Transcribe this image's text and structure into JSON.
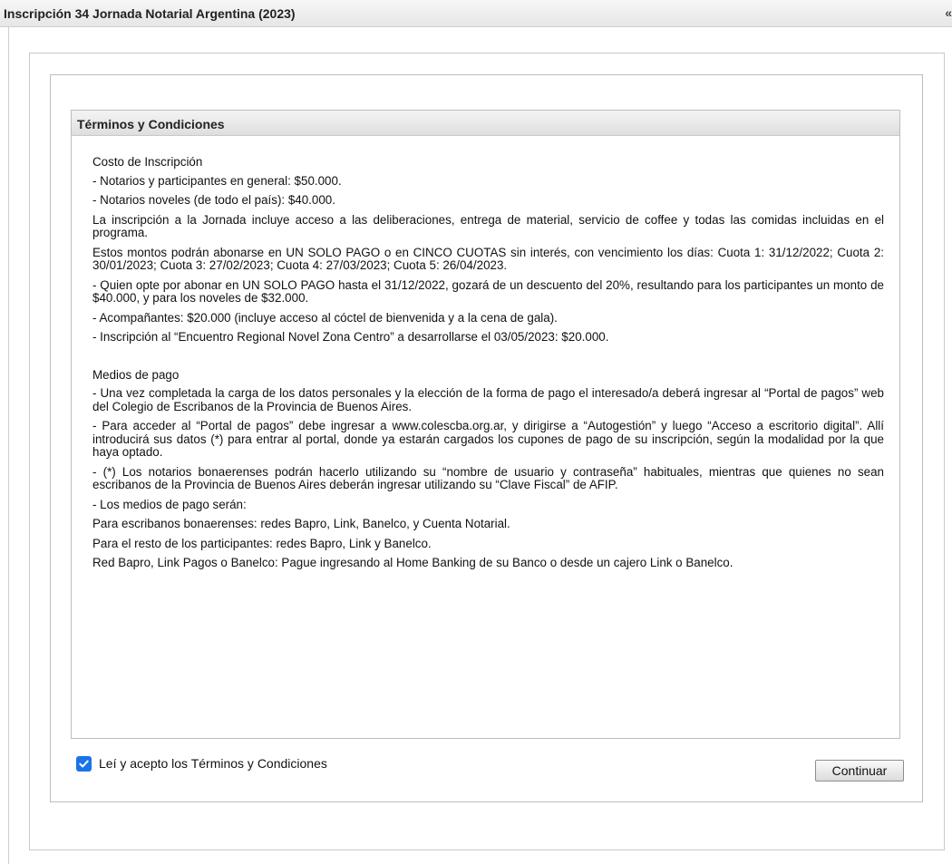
{
  "header": {
    "title": "Inscripción 34 Jornada Notarial Argentina (2023)",
    "collapse_icon": "«"
  },
  "terms": {
    "heading": "Términos y Condiciones",
    "paragraphs": [
      "Costo de Inscripción",
      "- Notarios y participantes en general: $50.000.",
      "- Notarios noveles (de todo el país): $40.000.",
      "La inscripción a la Jornada incluye acceso a las deliberaciones, entrega de material, servicio de coffee y todas las comidas incluidas en el programa.",
      "Estos montos podrán abonarse en UN SOLO PAGO o en CINCO CUOTAS sin interés, con vencimiento los días: Cuota 1: 31/12/2022; Cuota 2: 30/01/2023; Cuota 3: 27/02/2023; Cuota 4: 27/03/2023; Cuota 5: 26/04/2023.",
      "- Quien opte por abonar en UN SOLO PAGO hasta el 31/12/2022, gozará de un descuento del 20%, resultando para los participantes un monto de $40.000, y para los noveles de $32.000.",
      "- Acompañantes: $20.000 (incluye acceso al cóctel de bienvenida y a la cena de gala).",
      "- Inscripción al “Encuentro Regional Novel Zona Centro” a desarrollarse el 03/05/2023: $20.000.",
      "Medios de pago",
      "- Una vez completada la carga de los datos personales y la elección de la forma de pago el interesado/a deberá ingresar al “Portal de pagos” web del Colegio de Escribanos de la Provincia de Buenos Aires.",
      "- Para acceder al “Portal de pagos” debe ingresar a www.colescba.org.ar, y dirigirse a “Autogestión” y luego “Acceso a escritorio digital”. Allí introducirá sus datos (*) para entrar al portal, donde ya estarán cargados los cupones de pago de su inscripción, según la modalidad por la que haya optado.",
      "- (*) Los notarios bonaerenses podrán hacerlo utilizando su “nombre de usuario y contraseña” habituales, mientras que quienes no sean escribanos de la Provincia de Buenos Aires deberán ingresar utilizando su “Clave Fiscal” de AFIP.",
      "- Los medios de pago serán:",
      "Para escribanos bonaerenses: redes Bapro, Link, Banelco, y Cuenta Notarial.",
      "Para el resto de los participantes: redes Bapro, Link y Banelco.",
      "Red Bapro, Link Pagos o Banelco: Pague ingresando al Home Banking de su Banco o desde un cajero Link o Banelco."
    ]
  },
  "accept": {
    "checked": true,
    "label": "Leí y acepto los Términos y Condiciones",
    "checkbox_color": "#1a73e8"
  },
  "actions": {
    "continue_label": "Continuar"
  }
}
